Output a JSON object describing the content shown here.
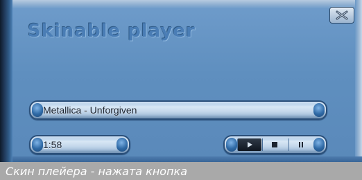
{
  "window": {
    "title": "Skinable player"
  },
  "track": {
    "name": "Metallica - Unforgiven"
  },
  "time": {
    "elapsed": "1:58"
  },
  "controls": {
    "play_icon": "play-icon",
    "stop_icon": "stop-icon",
    "pause_icon": "pause-icon",
    "pressed": "play"
  },
  "caption": {
    "text": "Скин плейера - нажата кнопка"
  },
  "colors": {
    "skin_blue": "#5f8fbf",
    "accent_dark": "#2a4f79",
    "caption_bg": "#a9a9a9"
  }
}
